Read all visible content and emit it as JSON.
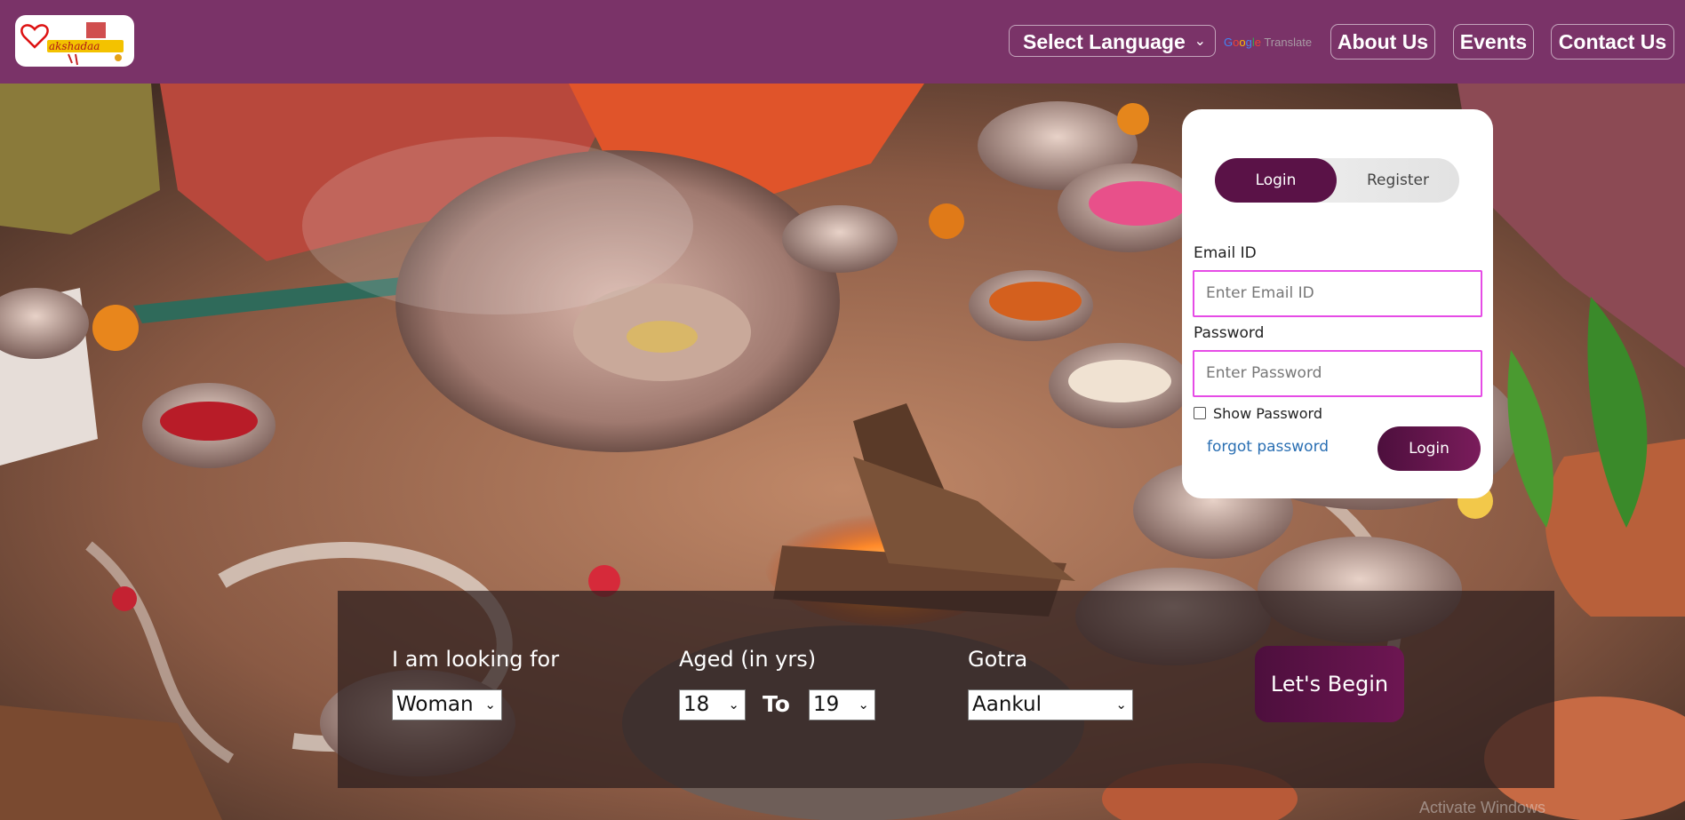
{
  "header": {
    "language_select": "Select Language",
    "google_translate_parts": [
      "G",
      "o",
      "o",
      "g",
      "l",
      "e"
    ],
    "translate_label": "Translate",
    "nav": {
      "about": "About Us",
      "events": "Events",
      "contact": "Contact Us"
    },
    "brand_color": "#7a3368"
  },
  "login": {
    "tabs": {
      "login": "Login",
      "register": "Register"
    },
    "active_tab": "Login",
    "email_label": "Email ID",
    "email_placeholder": "Enter Email ID",
    "password_label": "Password",
    "password_placeholder": "Enter Password",
    "show_password_label": "Show Password",
    "show_password_checked": false,
    "forgot_label": "forgot password",
    "submit_label": "Login",
    "accent_color": "#5a1247",
    "input_border_color": "#e64ce6"
  },
  "search": {
    "looking_for_label": "I am looking for",
    "looking_for_value": "Woman",
    "age_label": "Aged (in yrs)",
    "age_from": "18",
    "to_label": "To",
    "age_to": "19",
    "gotra_label": "Gotra",
    "gotra_value": "Aankul",
    "begin_label": "Let's Begin"
  },
  "os_watermark": "Activate Windows",
  "icons": {
    "logo": "akshadaa-logo",
    "select_chevron": "chevron-down-icon",
    "checkbox": "checkbox-icon"
  }
}
